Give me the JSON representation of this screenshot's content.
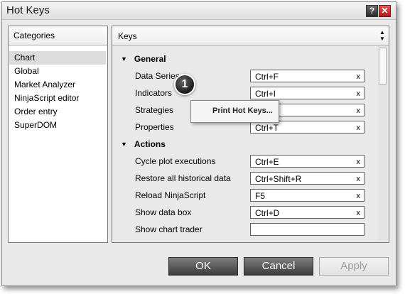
{
  "window": {
    "title": "Hot Keys",
    "help_label": "?",
    "close_label": "✕"
  },
  "categories": {
    "header": "Categories",
    "items": [
      "Chart",
      "Global",
      "Market Analyzer",
      "NinjaScript editor",
      "Order entry",
      "SuperDOM"
    ],
    "selected": "Chart"
  },
  "keys": {
    "header": "Keys",
    "sort_up": "▲",
    "sort_down": "▼",
    "groups": [
      {
        "name": "General",
        "collapse_icon": "▼"
      },
      {
        "name": "Actions",
        "collapse_icon": "▼"
      }
    ],
    "rows": [
      {
        "label": "Data Series",
        "value": "Ctrl+F",
        "clear": "x"
      },
      {
        "label": "Indicators",
        "value": "Ctrl+I",
        "clear": "x"
      },
      {
        "label": "Strategies",
        "value": "",
        "clear": "x"
      },
      {
        "label": "Properties",
        "value": "Ctrl+T",
        "clear": "x"
      },
      {
        "label": "Cycle plot executions",
        "value": "Ctrl+E",
        "clear": "x"
      },
      {
        "label": "Restore all historical data",
        "value": "Ctrl+Shift+R",
        "clear": "x"
      },
      {
        "label": "Reload NinjaScript",
        "value": "F5",
        "clear": "x"
      },
      {
        "label": "Show data box",
        "value": "Ctrl+D",
        "clear": "x"
      },
      {
        "label": "Show chart trader",
        "value": "",
        "clear": ""
      }
    ]
  },
  "context_menu": {
    "item": "Print Hot Keys..."
  },
  "callout": {
    "number": "1"
  },
  "buttons": {
    "ok": "OK",
    "cancel": "Cancel",
    "apply": "Apply"
  },
  "colors": {
    "close_red": "#c62828",
    "button_dark": "#4a4a4a",
    "selection": "#dcdcdc"
  }
}
